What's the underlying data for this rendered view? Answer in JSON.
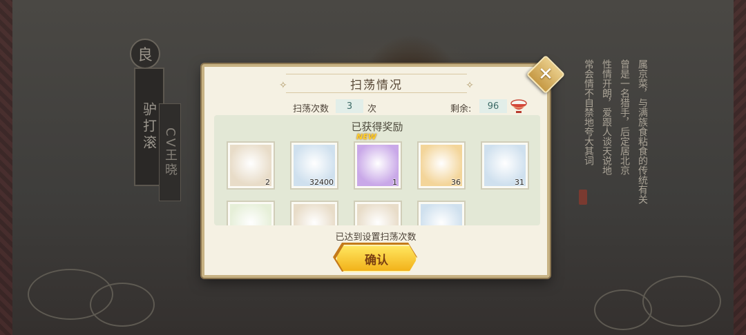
{
  "background": {
    "grade_char": "良",
    "character_name": "驴打滚",
    "cv_text": "CV王晓",
    "description_columns": [
      "属京菜，与满族食粘食的传统有关",
      "曾是一名猎手，后定居北京",
      "性情开朗，爱跟人谈天说地",
      "常会情不自禁地夸大其词"
    ]
  },
  "dialog": {
    "title": "扫荡情况",
    "sweep_count_label": "扫荡次数",
    "sweep_count_value": "3",
    "sweep_count_unit": "次",
    "remaining_label": "剩余:",
    "remaining_value": "96",
    "rewards_title": "已获得奖励",
    "status_text": "已达到设置扫荡次数",
    "confirm_label": "确认",
    "close_glyph": "✕"
  },
  "rewards": [
    {
      "name": "blonde-character-fragment",
      "count": "2",
      "new": false,
      "color": "#e8dcc8"
    },
    {
      "name": "dumpling",
      "count": "32400",
      "new": false,
      "color": "#cfe0ee"
    },
    {
      "name": "hat-character-fragment",
      "count": "1",
      "new": true,
      "new_label": "NEW",
      "color": "#c9a8e8"
    },
    {
      "name": "coin-token",
      "count": "36",
      "new": false,
      "color": "#f3d59a"
    },
    {
      "name": "rabbit-mochi",
      "count": "31",
      "new": false,
      "color": "#cfe0ee"
    },
    {
      "name": "red-hair-character-fragment",
      "count": "",
      "new": false,
      "color": "#e6efd8"
    },
    {
      "name": "brown-hair-character-fragment",
      "count": "",
      "new": false,
      "color": "#e8dcc8"
    },
    {
      "name": "green-eye-character-fragment",
      "count": "",
      "new": false,
      "color": "#e8dcc8"
    },
    {
      "name": "straw-hat-character-fragment",
      "count": "",
      "new": false,
      "color": "#cfe0ee"
    }
  ]
}
